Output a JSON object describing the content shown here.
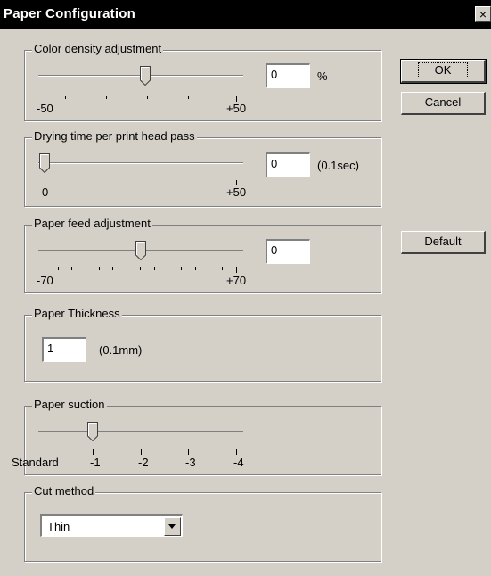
{
  "window": {
    "title": "Paper Configuration",
    "close_glyph": "×"
  },
  "buttons": {
    "ok": "OK",
    "cancel": "Cancel",
    "default": "Default"
  },
  "color_density": {
    "label": "Color density adjustment",
    "value": "0",
    "unit": "%",
    "min_label": "-50",
    "max_label": "+50",
    "slider_fraction": 0.5
  },
  "drying_time": {
    "label": "Drying time per print head pass",
    "value": "0",
    "unit": "(0.1sec)",
    "min_label": "0",
    "max_label": "+50",
    "slider_fraction": 0.0
  },
  "paper_feed": {
    "label": "Paper feed adjustment",
    "value": "0",
    "min_label": "-70",
    "max_label": "+70",
    "slider_fraction": 0.5
  },
  "paper_thickness": {
    "label": "Paper Thickness",
    "value": "1",
    "unit": "(0.1mm)"
  },
  "paper_suction": {
    "label": "Paper suction",
    "ticks": [
      "Standard",
      "-1",
      "-2",
      "-3",
      "-4"
    ],
    "selected_index": 1
  },
  "cut_method": {
    "label": "Cut method",
    "selected": "Thin"
  }
}
